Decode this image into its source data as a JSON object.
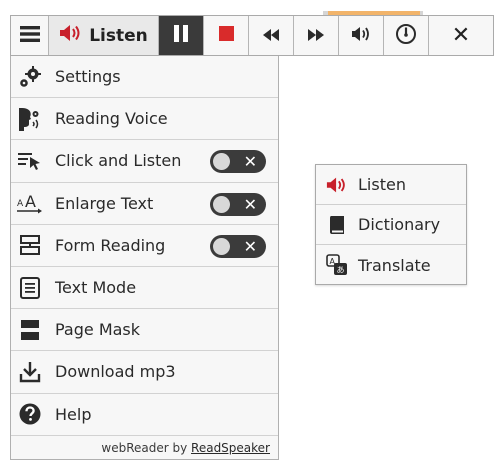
{
  "colors": {
    "accent_red": "#c8202b",
    "toolbar_bg": "#f7f7f7",
    "pause_bg": "#3a3a3a",
    "toggle_bg": "#3b3b3b",
    "progress_orange": "#f2b46a"
  },
  "toolbar": {
    "menu_icon": "hamburger-icon",
    "listen_label": "Listen",
    "pause_icon": "pause-icon",
    "stop_icon": "stop-icon",
    "rewind_icon": "rewind-icon",
    "forward_icon": "fast-forward-icon",
    "volume_icon": "volume-icon",
    "speed_icon": "speed-icon",
    "close_label": "✕"
  },
  "menu": {
    "items": [
      {
        "label": "Settings",
        "icon": "gears-icon"
      },
      {
        "label": "Reading Voice",
        "icon": "reading-voice-icon"
      },
      {
        "label": "Click and Listen",
        "icon": "click-listen-icon",
        "toggle": false
      },
      {
        "label": "Enlarge Text",
        "icon": "enlarge-text-icon",
        "toggle": false
      },
      {
        "label": "Form Reading",
        "icon": "form-reading-icon",
        "toggle": false
      },
      {
        "label": "Text Mode",
        "icon": "text-mode-icon"
      },
      {
        "label": "Page Mask",
        "icon": "page-mask-icon"
      },
      {
        "label": "Download mp3",
        "icon": "download-icon"
      },
      {
        "label": "Help",
        "icon": "help-icon"
      }
    ],
    "toggle_off_symbol": "✕",
    "footer_prefix": "webReader by ",
    "footer_link": "ReadSpeaker"
  },
  "popup": {
    "items": [
      {
        "label": "Listen",
        "icon": "speaker-icon"
      },
      {
        "label": "Dictionary",
        "icon": "book-icon"
      },
      {
        "label": "Translate",
        "icon": "translate-icon"
      }
    ]
  }
}
